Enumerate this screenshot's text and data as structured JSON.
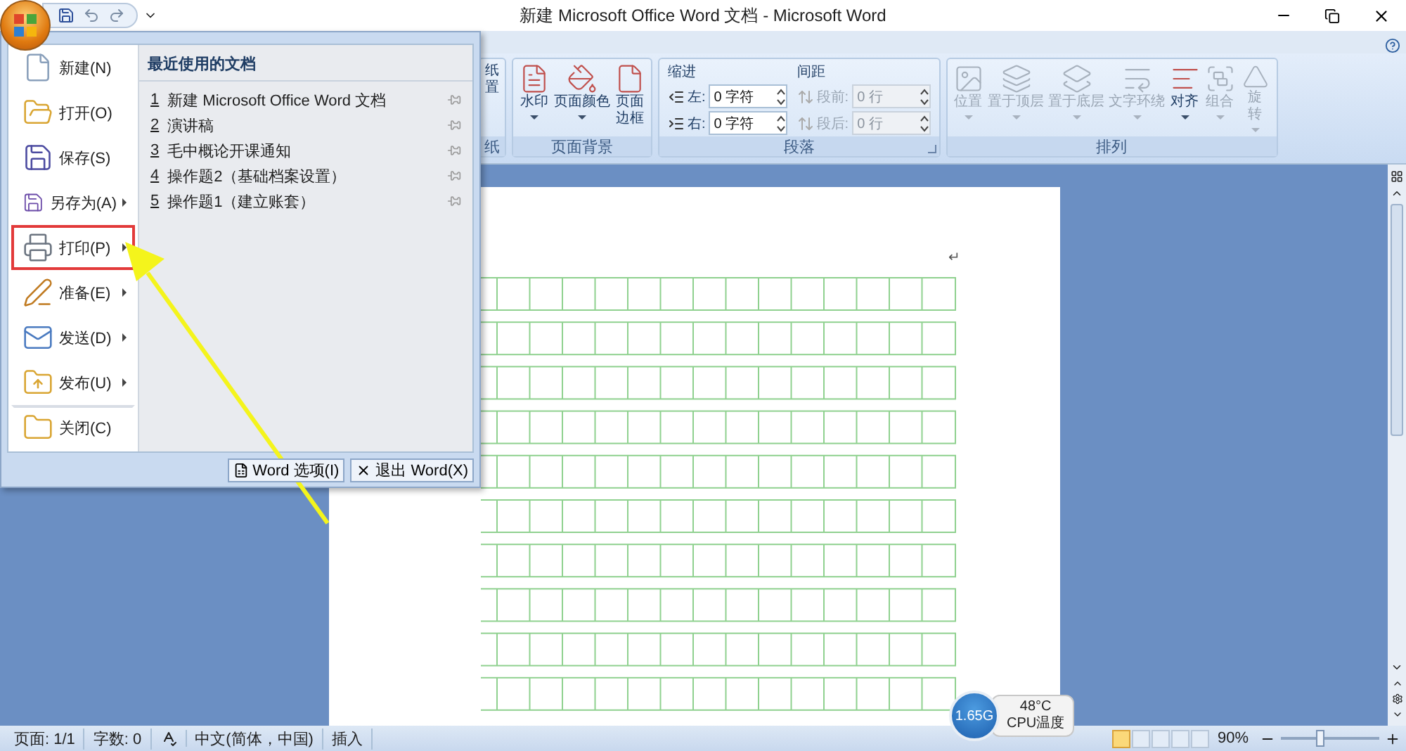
{
  "title_bar": {
    "title": "新建 Microsoft Office Word 文档 - Microsoft Word"
  },
  "ribbon": {
    "groups": [
      {
        "kind": "buttons",
        "label": "纸",
        "buttons": [
          {
            "lines": [
              "纸",
              "置"
            ],
            "dropdown": false,
            "disabled": false
          }
        ]
      },
      {
        "kind": "buttons",
        "label": "页面背景",
        "buttons": [
          {
            "lines": [
              "水印"
            ],
            "dropdown": true,
            "disabled": false
          },
          {
            "lines": [
              "页面颜色"
            ],
            "dropdown": true,
            "disabled": false
          },
          {
            "lines": [
              "页面",
              "边框"
            ],
            "dropdown": false,
            "disabled": false
          }
        ]
      },
      {
        "kind": "paragraph",
        "label": "段落",
        "sections": [
          {
            "heading": "缩进",
            "fields": [
              {
                "label": "左:",
                "value": "0 字符",
                "disabled": false
              },
              {
                "label": "右:",
                "value": "0 字符",
                "disabled": false
              }
            ]
          },
          {
            "heading": "间距",
            "fields": [
              {
                "label": "段前:",
                "value": "0 行",
                "disabled": true
              },
              {
                "label": "段后:",
                "value": "0 行",
                "disabled": true
              }
            ]
          }
        ]
      },
      {
        "kind": "buttons",
        "label": "排列",
        "buttons": [
          {
            "lines": [
              "位置"
            ],
            "dropdown": true,
            "disabled": true
          },
          {
            "lines": [
              "置于顶层"
            ],
            "dropdown": true,
            "disabled": true
          },
          {
            "lines": [
              "置于底层"
            ],
            "dropdown": true,
            "disabled": true
          },
          {
            "lines": [
              "文字环绕"
            ],
            "dropdown": true,
            "disabled": true
          },
          {
            "lines": [
              "对齐"
            ],
            "dropdown": true,
            "disabled": false
          },
          {
            "lines": [
              "组合"
            ],
            "dropdown": true,
            "disabled": true
          },
          {
            "lines": [
              "旋",
              "转"
            ],
            "dropdown": true,
            "disabled": true
          }
        ]
      }
    ]
  },
  "office_menu": {
    "items": [
      {
        "label": "新建(N)",
        "submenu": false,
        "highlighted": false,
        "divider_before": false
      },
      {
        "label": "打开(O)",
        "submenu": false,
        "highlighted": false,
        "divider_before": false
      },
      {
        "label": "保存(S)",
        "submenu": false,
        "highlighted": false,
        "divider_before": false
      },
      {
        "label": "另存为(A)",
        "submenu": true,
        "highlighted": false,
        "divider_before": false
      },
      {
        "label": "打印(P)",
        "submenu": true,
        "highlighted": true,
        "divider_before": false
      },
      {
        "label": "准备(E)",
        "submenu": true,
        "highlighted": false,
        "divider_before": false
      },
      {
        "label": "发送(D)",
        "submenu": true,
        "highlighted": false,
        "divider_before": false
      },
      {
        "label": "发布(U)",
        "submenu": true,
        "highlighted": false,
        "divider_before": false
      },
      {
        "label": "关闭(C)",
        "submenu": false,
        "highlighted": false,
        "divider_before": true
      }
    ],
    "recent_heading": "最近使用的文档",
    "recent": [
      {
        "number": "1",
        "name": "新建 Microsoft Office Word 文档"
      },
      {
        "number": "2",
        "name": "演讲稿"
      },
      {
        "number": "3",
        "name": "毛中概论开课通知"
      },
      {
        "number": "4",
        "name": "操作题2（基础档案设置）"
      },
      {
        "number": "5",
        "name": "操作题1（建立账套）"
      }
    ],
    "buttons": [
      {
        "kind": "options",
        "label": "Word 选项(I)"
      },
      {
        "kind": "exit",
        "label": "退出 Word(X)"
      }
    ]
  },
  "annotation": {
    "arrow": true
  },
  "document": {
    "return_mark": "↵"
  },
  "cpu_widget": {
    "speed": "1.65G",
    "temperature": "48°C",
    "label": "CPU温度"
  },
  "status_bar": {
    "items": [
      {
        "kind": "text",
        "label": "页面: 1/1"
      },
      {
        "kind": "text",
        "label": "字数: 0"
      },
      {
        "kind": "spell"
      },
      {
        "kind": "text",
        "label": "中文(简体，中国)"
      },
      {
        "kind": "text",
        "label": "插入"
      }
    ],
    "views": [
      {
        "selected": true
      },
      {
        "selected": false
      },
      {
        "selected": false
      },
      {
        "selected": false
      },
      {
        "selected": false
      }
    ],
    "zoom": {
      "reading": "90%",
      "level": 0.4
    }
  }
}
